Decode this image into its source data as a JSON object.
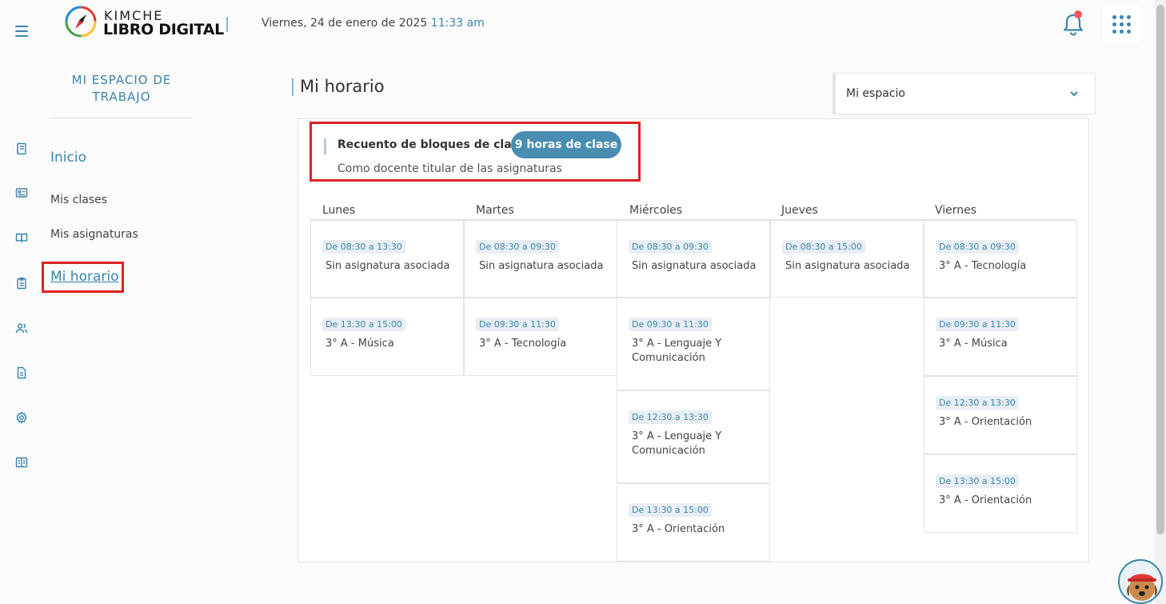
{
  "header": {
    "logo_line1": "KIMCHE",
    "logo_line2": "LIBRO DIGITAL",
    "date": "Viernes, 24 de enero de 2025",
    "time": "11:33 am"
  },
  "sidebar": {
    "workspace_title": "MI ESPACIO DE TRABAJO",
    "items": [
      {
        "label": "Inicio"
      },
      {
        "label": "Mis clases"
      },
      {
        "label": "Mis asignaturas"
      },
      {
        "label": "Mi horario"
      }
    ]
  },
  "rail_icons": [
    "notebook-icon",
    "id-card-icon",
    "book-open-icon",
    "clipboard-icon",
    "users-icon",
    "document-icon",
    "gear-icon",
    "book-icon"
  ],
  "main": {
    "title": "Mi horario",
    "space_select": {
      "value": "Mi espacio"
    },
    "summary": {
      "label": "Recuento de bloques de clase:",
      "badge": "9 horas de clase",
      "subtitle": "Como docente titular de las asignaturas"
    },
    "days": [
      {
        "name": "Lunes",
        "blocks": [
          {
            "time": "De 08:30 a 13:30",
            "subject": "Sin asignatura asociada"
          },
          {
            "time": "De 13:30 a 15:00",
            "subject": "3° A - Música"
          }
        ]
      },
      {
        "name": "Martes",
        "blocks": [
          {
            "time": "De 08:30 a 09:30",
            "subject": "Sin asignatura asociada"
          },
          {
            "time": "De 09:30 a 11:30",
            "subject": "3° A - Tecnología"
          }
        ]
      },
      {
        "name": "Miércoles",
        "blocks": [
          {
            "time": "De 08:30 a 09:30",
            "subject": "Sin asignatura asociada"
          },
          {
            "time": "De 09:30 a 11:30",
            "subject": "3° A - Lenguaje Y Comunicación"
          },
          {
            "time": "De 12:30 a 13:30",
            "subject": "3° A - Lenguaje Y Comunicación"
          },
          {
            "time": "De 13:30 a 15:00",
            "subject": "3° A - Orientación"
          }
        ]
      },
      {
        "name": "Jueves",
        "blocks": [
          {
            "time": "De 08:30 a 15:00",
            "subject": "Sin asignatura asociada"
          }
        ]
      },
      {
        "name": "Viernes",
        "blocks": [
          {
            "time": "De 08:30 a 09:30",
            "subject": "3° A - Tecnología"
          },
          {
            "time": "De 09:30 a 11:30",
            "subject": "3° A - Música"
          },
          {
            "time": "De 12:30 a 13:30",
            "subject": "3° A - Orientación"
          },
          {
            "time": "De 13:30 a 15:00",
            "subject": "3° A - Orientación"
          }
        ]
      }
    ]
  },
  "colors": {
    "accent": "#3a85ad",
    "badge": "#4a8db3",
    "highlight": "#dd2222",
    "notification": "#ef5a5a"
  }
}
